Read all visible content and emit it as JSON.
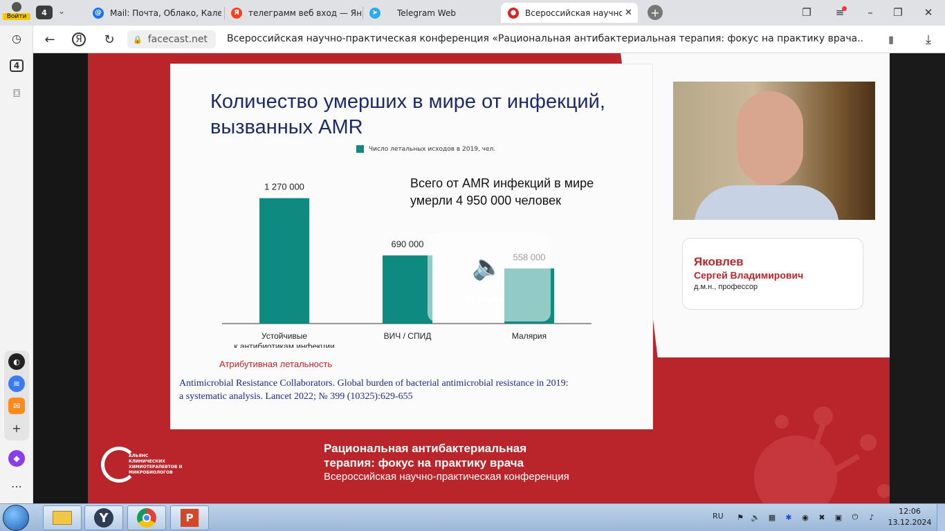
{
  "browser": {
    "profile_label": "Войти",
    "tab_count": "4",
    "tabs": [
      {
        "title": "Mail: Почта, Облако, Кале",
        "icon": "at-icon",
        "color": "#1a73e8"
      },
      {
        "title": "телеграмм веб вход — Ян",
        "icon": "yandex-icon",
        "color": "#fc3f1d"
      },
      {
        "title": "Telegram Web",
        "icon": "telegram-icon",
        "color": "#2aabee"
      },
      {
        "title": "Всероссийская научно",
        "icon": "facecast-icon",
        "color": "#e02020"
      }
    ],
    "yandex_letter": "Я",
    "domain": "facecast.net",
    "page_title": "Всероссийская научно-практическая конференция «Рациональная антибактериальная терапия: фокус на практику врача...",
    "sidebar_count": "4"
  },
  "slide": {
    "title_line1": "Количество умерших в мире от инфекций,",
    "title_line2": "вызванных AMR",
    "summary_line1": "Всего от AMR инфекций в мире",
    "summary_line2": "умерли 4 950 000 человек",
    "attribution": "Атрибутивная летальность",
    "reference_line1": "Antimicrobial Resistance Collaborators. Global burden of bacterial antimicrobial resistance in 2019:",
    "reference_line2": "a systematic analysis. Lancet 2022; № 399 (10325):629-655"
  },
  "chart_data": {
    "type": "bar",
    "legend": "Число летальных исходов  в 2019, чел.",
    "categories": [
      "Устойчивые|к антибиотикам инфекции",
      "ВИЧ / СПИД",
      "Малярия"
    ],
    "values": [
      1270000,
      690000,
      558000
    ],
    "value_labels": [
      "1 270 000",
      "690 000",
      "558 000"
    ],
    "ylim": [
      0,
      1400000
    ],
    "color": "#0e8a80"
  },
  "player": {
    "unmute_label": "Unmute"
  },
  "speaker": {
    "surname": "Яковлев",
    "name": "Сергей Владимирович",
    "title": "д.м.н., профессор"
  },
  "footer": {
    "logo_text": "АЛЬЯНС КЛИНИЧЕСКИХ ХИМИОТЕРАПЕВТОВ И МИКРОБИОЛОГОВ",
    "conf_line1": "Рациональная антибактериальная",
    "conf_line2": "терапия: фокус на практику врача",
    "conf_line3": "Всероссийская научно-практическая конференция"
  },
  "taskbar": {
    "lang": "RU",
    "time": "12:06",
    "date": "13.12.2024"
  },
  "colors": {
    "accent_red": "#b9252a",
    "teal": "#0e8a80",
    "title_navy": "#1c2a6b"
  }
}
